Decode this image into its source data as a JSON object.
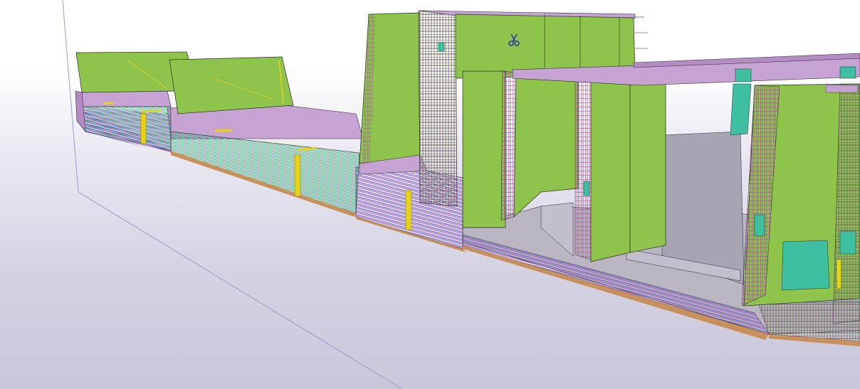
{
  "viewport": {
    "background_top": "#ffffff",
    "background_bottom": "#c8c6d9"
  },
  "colors": {
    "concrete_green": "#8ec34c",
    "concrete_green_dark": "#6fa23a",
    "slab_purple": "#b48bc4",
    "slab_purple_light": "#c7a3d4",
    "rebar_magenta": "#b03aa0",
    "rebar_green": "#3a9a2a",
    "rebar_blue": "#3a4ad0",
    "rebar_cyan": "#2ab0b0",
    "embed_yellow": "#e5d21a",
    "column_teal": "#3dbfa0",
    "floor_grey": "#b9b6c2",
    "base_orange": "#c8905a",
    "outline": "#2b2b2b"
  },
  "icons": {
    "cut_tool": "scissors-icon"
  }
}
